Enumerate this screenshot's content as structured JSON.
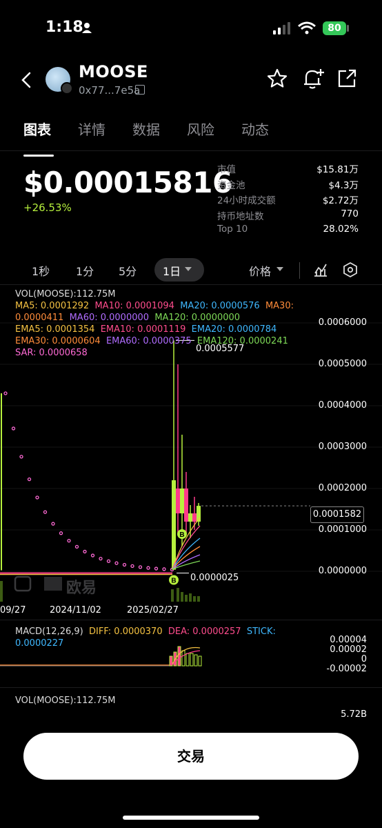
{
  "status_bar": {
    "time": "1:18",
    "battery": "80"
  },
  "header": {
    "coin_name": "MOOSE",
    "address": "0x77...7e5a"
  },
  "tabs": [
    {
      "label": "图表"
    },
    {
      "label": "详情"
    },
    {
      "label": "数据"
    },
    {
      "label": "风险"
    },
    {
      "label": "动态"
    }
  ],
  "price": {
    "value": "$0.00015816",
    "change": "+26.53%"
  },
  "stats": [
    {
      "label": "市值",
      "value": "$15.81万"
    },
    {
      "label": "资金池",
      "value": "$4.3万"
    },
    {
      "label": "24小时成交额",
      "value": "$2.72万"
    },
    {
      "label": "持币地址数",
      "value": "770"
    },
    {
      "label": "Top 10",
      "value": "28.02%"
    }
  ],
  "timeframes": {
    "items": [
      {
        "label": "1秒"
      },
      {
        "label": "1分"
      },
      {
        "label": "5分"
      },
      {
        "label": "1日"
      }
    ],
    "price_toggle": "价格"
  },
  "legend": {
    "vol": "VOL(MOOSE):112.75M",
    "ma5": "MA5: 0.0001292",
    "ma10": "MA10: 0.0001094",
    "ma20": "MA20: 0.0000576",
    "ma30": "MA30:",
    "ma30_val": "0.0000411",
    "ma60": "MA60: 0.0000000",
    "ma120": "MA120: 0.0000000",
    "ema5": "EMA5: 0.0001354",
    "ema10": "EMA10: 0.0001119",
    "ema20": "EMA20: 0.0000784",
    "ema30": "EMA30: 0.0000604",
    "ema60": "EMA60: 0.0000375",
    "ema120": "EMA120: 0.0000241",
    "sar": "SAR: 0.0000658"
  },
  "chart": {
    "y_ticks": [
      "0.0006000",
      "0.0005000",
      "0.0004000",
      "0.0003000",
      "0.0002000",
      "0.0001000",
      "0.0000000"
    ],
    "x_ticks": [
      "09/27",
      "2024/11/02",
      "2025/02/27"
    ],
    "high_label": "0.0005577",
    "low_label": "0.0000025",
    "current_price": "0.0001582",
    "watermark": "欧易",
    "marker_b": "B"
  },
  "macd": {
    "label": "MACD(12,26,9)",
    "diff": "DIFF: 0.0000370",
    "dea": "DEA: 0.0000257",
    "stick": "STICK:",
    "stick_val": "0.0000227",
    "y_ticks": [
      "0.00004",
      "0.00002",
      "0",
      "-0.00002"
    ]
  },
  "vol_panel": {
    "label": "VOL(MOOSE):112.75M",
    "y_tick": "5.72B"
  },
  "trade_button": "交易",
  "colors": {
    "ma5": "#f5c242",
    "ma10": "#ff4d8d",
    "ma20": "#3fb8ff",
    "ma30": "#ff8c3a",
    "ma60": "#b06cff",
    "ma120": "#7ed957",
    "ema5": "#f5c242",
    "ema10": "#ff4d8d",
    "ema20": "#3fb8ff",
    "ema30": "#ff8c3a",
    "ema60": "#b06cff",
    "ema120": "#7ed957",
    "sar": "#ff6ad5",
    "up": "#b7f13d",
    "down": "#ff3b8a"
  }
}
